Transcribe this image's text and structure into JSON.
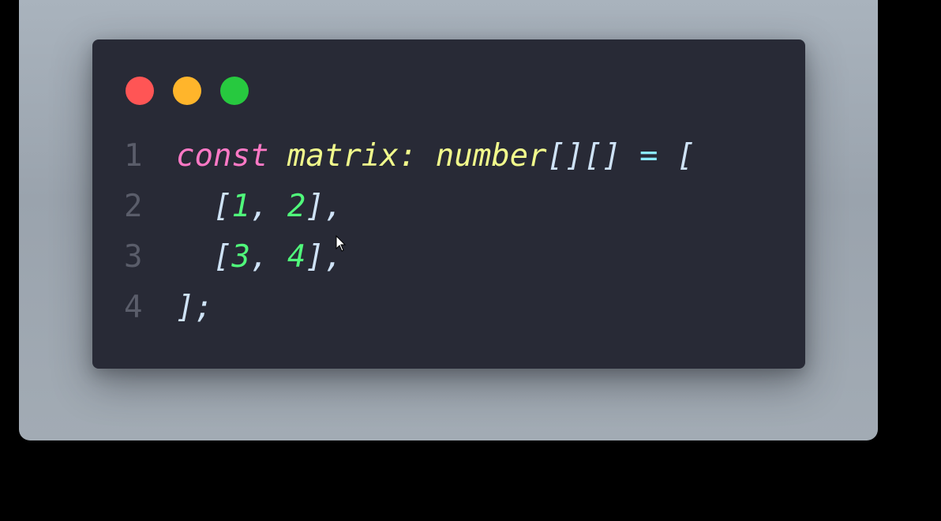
{
  "window": {
    "controls": [
      {
        "name": "close",
        "color": "#ff5555"
      },
      {
        "name": "minimize",
        "color": "#ffb52b"
      },
      {
        "name": "maximize",
        "color": "#27c93f"
      }
    ]
  },
  "colors": {
    "keyword": "#ff79c6",
    "identifier": "#f1fa8c",
    "punctuation": "#f8f8f2",
    "operator": "#8be9fd",
    "number": "#50fa7b",
    "bracket": "#cfe3f7",
    "line_number": "#5a5d6a"
  },
  "code": {
    "lines": [
      {
        "number": "1",
        "tokens": [
          {
            "text": "const",
            "kind": "keyword"
          },
          {
            "text": " ",
            "kind": "punctuation"
          },
          {
            "text": "matrix",
            "kind": "identifier"
          },
          {
            "text": ":",
            "kind": "identifier"
          },
          {
            "text": " ",
            "kind": "punctuation"
          },
          {
            "text": "number",
            "kind": "identifier"
          },
          {
            "text": "[][]",
            "kind": "bracket"
          },
          {
            "text": " ",
            "kind": "punctuation"
          },
          {
            "text": "=",
            "kind": "operator"
          },
          {
            "text": " ",
            "kind": "punctuation"
          },
          {
            "text": "[",
            "kind": "bracket"
          }
        ]
      },
      {
        "number": "2",
        "tokens": [
          {
            "text": "  ",
            "kind": "punctuation"
          },
          {
            "text": "[",
            "kind": "bracket"
          },
          {
            "text": "1",
            "kind": "number"
          },
          {
            "text": ", ",
            "kind": "bracket"
          },
          {
            "text": "2",
            "kind": "number"
          },
          {
            "text": "],",
            "kind": "bracket"
          }
        ]
      },
      {
        "number": "3",
        "tokens": [
          {
            "text": "  ",
            "kind": "punctuation"
          },
          {
            "text": "[",
            "kind": "bracket"
          },
          {
            "text": "3",
            "kind": "number"
          },
          {
            "text": ", ",
            "kind": "bracket"
          },
          {
            "text": "4",
            "kind": "number"
          },
          {
            "text": "],",
            "kind": "bracket"
          }
        ]
      },
      {
        "number": "4",
        "tokens": [
          {
            "text": "];",
            "kind": "bracket"
          }
        ]
      }
    ]
  }
}
